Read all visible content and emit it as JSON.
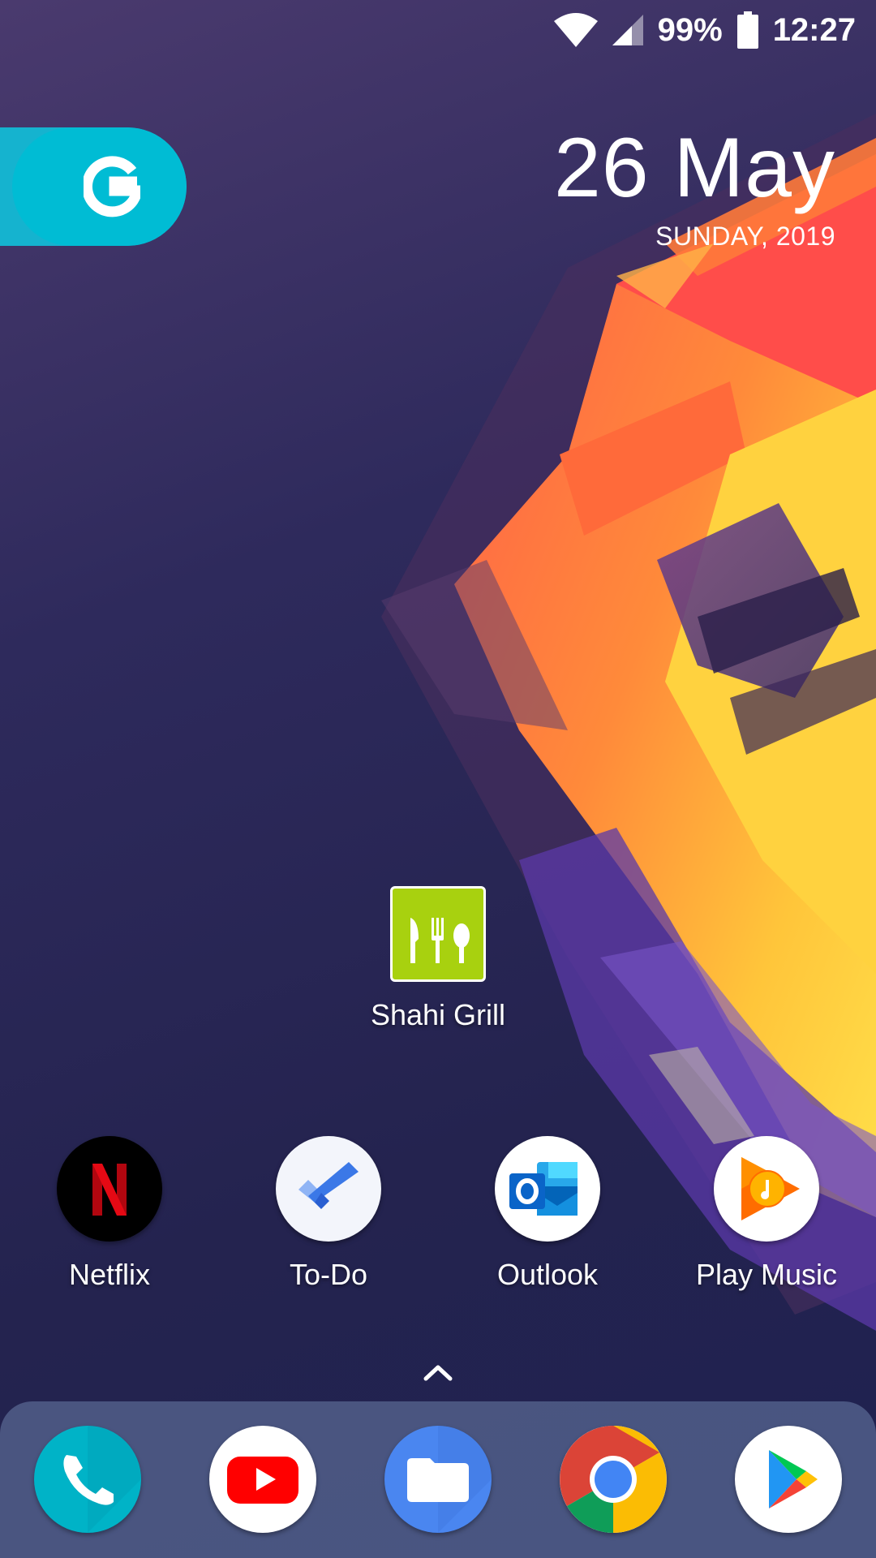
{
  "status_bar": {
    "battery_percent": "99%",
    "time": "12:27",
    "icons": [
      "wifi-icon",
      "cellular-signal-icon",
      "battery-icon"
    ]
  },
  "search_widget": {
    "icon": "google-g-icon",
    "color": "#00bcd4"
  },
  "date_widget": {
    "date": "26 May",
    "weekday_year": "SUNDAY, 2019"
  },
  "home_apps": [
    {
      "label": "Shahi Grill",
      "icon": "utensils-icon",
      "color": "#a8d10f"
    }
  ],
  "app_row": [
    {
      "label": "Netflix",
      "icon": "netflix-icon",
      "color": "#e50914"
    },
    {
      "label": "To-Do",
      "icon": "todo-check-icon",
      "color": "#3b78e7"
    },
    {
      "label": "Outlook",
      "icon": "outlook-icon",
      "color": "#0a64c8"
    },
    {
      "label": "Play Music",
      "icon": "play-music-icon",
      "color": "#ff6d00"
    }
  ],
  "app_drawer_handle": {
    "icon": "chevron-up-icon"
  },
  "dock": [
    {
      "app": "Phone",
      "icon": "phone-icon",
      "color": "#00acc1"
    },
    {
      "app": "YouTube",
      "icon": "youtube-icon",
      "color": "#ff0000"
    },
    {
      "app": "Files",
      "icon": "folder-icon",
      "color": "#4285f4"
    },
    {
      "app": "Chrome",
      "icon": "chrome-icon",
      "color": "#4285f4"
    },
    {
      "app": "Play Store",
      "icon": "play-store-icon",
      "color": "#01875f"
    }
  ]
}
